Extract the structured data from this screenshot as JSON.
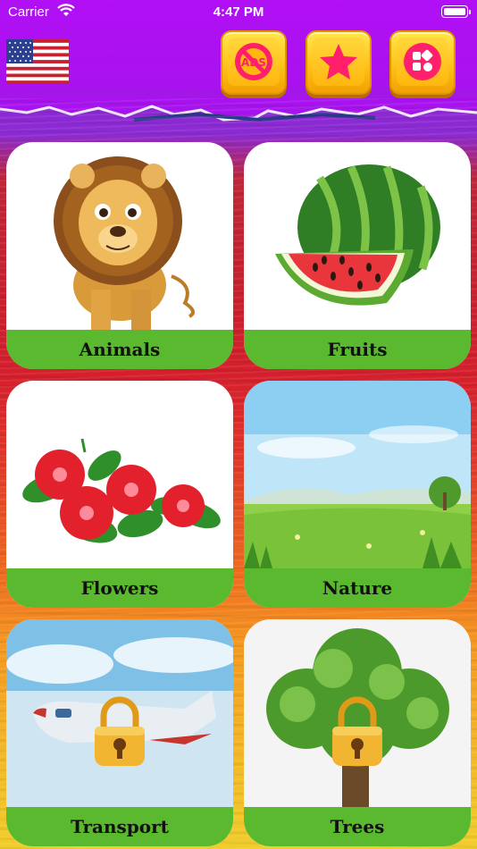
{
  "status_bar": {
    "carrier": "Carrier",
    "time": "4:47 PM"
  },
  "header": {
    "language_flag": "us-flag-icon",
    "buttons": [
      {
        "name": "remove-ads-button",
        "icon": "no-ads-icon",
        "text": "ADS"
      },
      {
        "name": "rate-button",
        "icon": "star-icon"
      },
      {
        "name": "more-apps-button",
        "icon": "apps-icon"
      }
    ]
  },
  "categories": [
    {
      "label": "Animals",
      "locked": false
    },
    {
      "label": "Fruits",
      "locked": false
    },
    {
      "label": "Flowers",
      "locked": false
    },
    {
      "label": "Nature",
      "locked": false
    },
    {
      "label": "Transport",
      "locked": true
    },
    {
      "label": "Trees",
      "locked": true
    }
  ],
  "colors": {
    "header": "#b10ff5",
    "label_bar": "#5ab92e",
    "button_gold": "#ffc21a",
    "accent_pink": "#ff1f6a"
  }
}
